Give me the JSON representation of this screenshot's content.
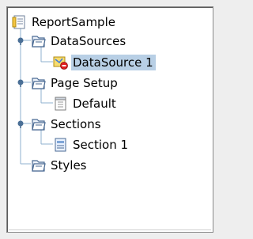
{
  "tree": {
    "root": {
      "label": "ReportSample",
      "icon": "report-icon"
    },
    "datasources": {
      "label": "DataSources",
      "icon": "folder-open-icon",
      "expanded": true
    },
    "datasource1": {
      "label": "DataSource 1",
      "icon": "datasource-error-icon",
      "selected": true
    },
    "pagesetup": {
      "label": "Page Setup",
      "icon": "folder-open-icon",
      "expanded": true
    },
    "default": {
      "label": "Default",
      "icon": "page-icon"
    },
    "sections": {
      "label": "Sections",
      "icon": "folder-open-icon",
      "expanded": true
    },
    "section1": {
      "label": "Section 1",
      "icon": "section-icon"
    },
    "styles": {
      "label": "Styles",
      "icon": "folder-open-icon"
    }
  },
  "colors": {
    "selection": "#b8cfe5",
    "connector_lines": "#8fb0cf",
    "toggle_handle": "#4a6f96",
    "folder_fill": "#eef3fb",
    "folder_stroke": "#4a6a93",
    "error_badge": "#e02020"
  }
}
